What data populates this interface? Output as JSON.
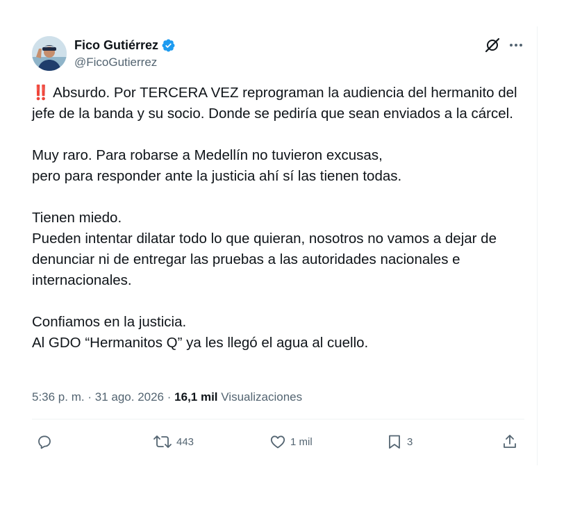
{
  "author": {
    "display_name": "Fico Gutiérrez",
    "handle": "@FicoGutierrez",
    "verified": true,
    "verified_color": "#1d9bf0"
  },
  "header_icons": [
    "grok-icon",
    "more-icon"
  ],
  "tweet": {
    "emoji": "‼️",
    "paragraphs": [
      [
        "Absurdo. Por TERCERA VEZ reprograman la audiencia del hermanito del jefe de la banda y su socio. Donde se pediría que sean enviados a la cárcel."
      ],
      [
        "Muy raro. Para robarse a Medellín no tuvieron excusas,",
        "pero para responder ante la justicia ahí sí las tienen todas."
      ],
      [
        "Tienen miedo.",
        "Pueden intentar dilatar todo lo que quieran, nosotros no vamos a dejar de denunciar ni de entregar las pruebas a las autoridades nacionales e internacionales."
      ],
      [
        "Confiamos en la justicia.",
        "Al GDO “Hermanitos Q” ya les llegó el agua al cuello."
      ]
    ]
  },
  "meta": {
    "time": "5:36 p. m.",
    "separator": "·",
    "date": "31 ago. 2026",
    "views_count": "16,1 mil",
    "views_label": "Visualizaciones"
  },
  "actions": {
    "reply": {
      "icon": "reply-icon",
      "count": ""
    },
    "retweet": {
      "icon": "retweet-icon",
      "count": "443"
    },
    "like": {
      "icon": "heart-icon",
      "count": "1 mil"
    },
    "bookmark": {
      "icon": "bookmark-icon",
      "count": "3"
    },
    "share": {
      "icon": "share-icon",
      "count": ""
    }
  },
  "colors": {
    "text": "#0f1419",
    "secondary": "#536471",
    "border": "#eff3f4",
    "emoji_red": "#d21f2a"
  }
}
